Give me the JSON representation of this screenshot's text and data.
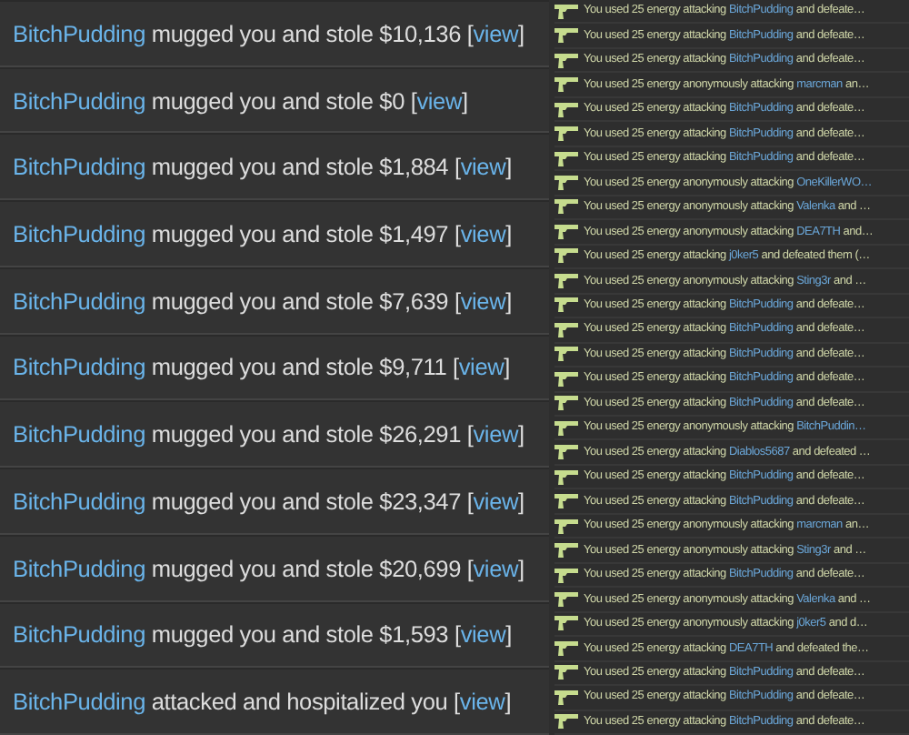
{
  "events": [
    {
      "actor": "BitchPudding",
      "action": "mugged you and stole $10,136 [",
      "link": "view",
      "close": "]"
    },
    {
      "actor": "BitchPudding",
      "action": "mugged you and stole $0 [",
      "link": "view",
      "close": "]"
    },
    {
      "actor": "BitchPudding",
      "action": "mugged you and stole $1,884 [",
      "link": "view",
      "close": "]"
    },
    {
      "actor": "BitchPudding",
      "action": "mugged you and stole $1,497 [",
      "link": "view",
      "close": "]"
    },
    {
      "actor": "BitchPudding",
      "action": "mugged you and stole $7,639 [",
      "link": "view",
      "close": "]"
    },
    {
      "actor": "BitchPudding",
      "action": "mugged you and stole $9,711 [",
      "link": "view",
      "close": "]"
    },
    {
      "actor": "BitchPudding",
      "action": "mugged you and stole $26,291 [",
      "link": "view",
      "close": "]"
    },
    {
      "actor": "BitchPudding",
      "action": "mugged you and stole $23,347 [",
      "link": "view",
      "close": "]"
    },
    {
      "actor": "BitchPudding",
      "action": "mugged you and stole $20,699 [",
      "link": "view",
      "close": "]"
    },
    {
      "actor": "BitchPudding",
      "action": "mugged you and stole $1,593 [",
      "link": "view",
      "close": "]"
    },
    {
      "actor": "BitchPudding",
      "action": "attacked and hospitalized you [",
      "link": "view",
      "close": "]"
    }
  ],
  "attack_log": [
    {
      "prefix": "You used 25 energy attacking",
      "target": "BitchPudding",
      "suffix": "and defeate…"
    },
    {
      "prefix": "You used 25 energy attacking",
      "target": "BitchPudding",
      "suffix": "and defeate…"
    },
    {
      "prefix": "You used 25 energy attacking",
      "target": "BitchPudding",
      "suffix": "and defeate…"
    },
    {
      "prefix": "You used 25 energy anonymously attacking",
      "target": "marcman",
      "suffix": "an…"
    },
    {
      "prefix": "You used 25 energy attacking",
      "target": "BitchPudding",
      "suffix": "and defeate…"
    },
    {
      "prefix": "You used 25 energy attacking",
      "target": "BitchPudding",
      "suffix": "and defeate…"
    },
    {
      "prefix": "You used 25 energy attacking",
      "target": "BitchPudding",
      "suffix": "and defeate…"
    },
    {
      "prefix": "You used 25 energy anonymously attacking",
      "target": "OneKillerWO…"
    },
    {
      "prefix": "You used 25 energy anonymously attacking",
      "target": "Valenka",
      "suffix": "and …"
    },
    {
      "prefix": "You used 25 energy anonymously attacking",
      "target": "DEA7TH",
      "suffix": "and…"
    },
    {
      "prefix": "You used 25 energy attacking",
      "target": "j0ker5",
      "suffix": "and defeated them (…"
    },
    {
      "prefix": "You used 25 energy anonymously attacking",
      "target": "Sting3r",
      "suffix": "and …"
    },
    {
      "prefix": "You used 25 energy attacking",
      "target": "BitchPudding",
      "suffix": "and defeate…"
    },
    {
      "prefix": "You used 25 energy attacking",
      "target": "BitchPudding",
      "suffix": "and defeate…"
    },
    {
      "prefix": "You used 25 energy attacking",
      "target": "BitchPudding",
      "suffix": "and defeate…"
    },
    {
      "prefix": "You used 25 energy attacking",
      "target": "BitchPudding",
      "suffix": "and defeate…"
    },
    {
      "prefix": "You used 25 energy attacking",
      "target": "BitchPudding",
      "suffix": "and defeate…"
    },
    {
      "prefix": "You used 25 energy anonymously attacking",
      "target": "BitchPuddin…"
    },
    {
      "prefix": "You used 25 energy attacking",
      "target": "Diablos5687",
      "suffix": "and defeated …"
    },
    {
      "prefix": "You used 25 energy attacking",
      "target": "BitchPudding",
      "suffix": "and defeate…"
    },
    {
      "prefix": "You used 25 energy attacking",
      "target": "BitchPudding",
      "suffix": "and defeate…"
    },
    {
      "prefix": "You used 25 energy anonymously attacking",
      "target": "marcman",
      "suffix": "an…"
    },
    {
      "prefix": "You used 25 energy anonymously attacking",
      "target": "Sting3r",
      "suffix": "and …"
    },
    {
      "prefix": "You used 25 energy attacking",
      "target": "BitchPudding",
      "suffix": "and defeate…"
    },
    {
      "prefix": "You used 25 energy anonymously attacking",
      "target": "Valenka",
      "suffix": "and …"
    },
    {
      "prefix": "You used 25 energy anonymously attacking",
      "target": "j0ker5",
      "suffix": "and d…"
    },
    {
      "prefix": "You used 25 energy attacking",
      "target": "DEA7TH",
      "suffix": "and defeated the…"
    },
    {
      "prefix": "You used 25 energy attacking",
      "target": "BitchPudding",
      "suffix": "and defeate…"
    },
    {
      "prefix": "You used 25 energy attacking",
      "target": "BitchPudding",
      "suffix": "and defeate…"
    },
    {
      "prefix": "You used 25 energy attacking",
      "target": "BitchPudding",
      "suffix": "and defeate…"
    }
  ]
}
